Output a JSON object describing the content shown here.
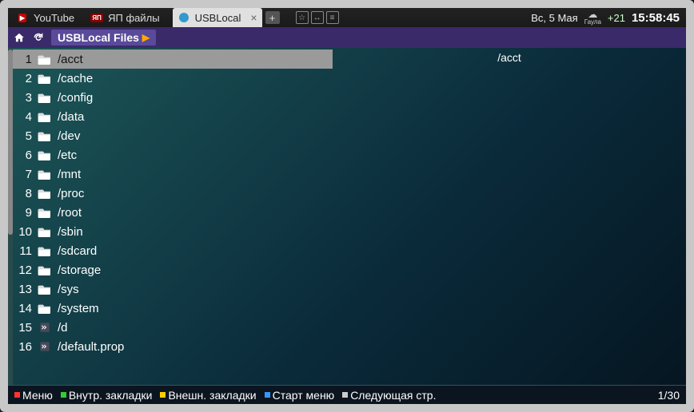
{
  "taskbar": {
    "items": [
      {
        "label": "YouTube",
        "icon": "youtube"
      },
      {
        "label": "ЯП файлы",
        "icon": "yp"
      },
      {
        "label": "USBLocal",
        "icon": "usb",
        "active": true
      }
    ],
    "date": "Вс, 5 Мая",
    "weather_temp": "+21",
    "weather_city": "Гаула",
    "clock": "15:58:45"
  },
  "navbar": {
    "breadcrumb": "USBLocal Files"
  },
  "files": [
    {
      "num": "1",
      "name": "/acct",
      "type": "folder",
      "selected": true
    },
    {
      "num": "2",
      "name": "/cache",
      "type": "folder"
    },
    {
      "num": "3",
      "name": "/config",
      "type": "folder"
    },
    {
      "num": "4",
      "name": "/data",
      "type": "folder"
    },
    {
      "num": "5",
      "name": "/dev",
      "type": "folder"
    },
    {
      "num": "6",
      "name": "/etc",
      "type": "folder"
    },
    {
      "num": "7",
      "name": "/mnt",
      "type": "folder"
    },
    {
      "num": "8",
      "name": "/proc",
      "type": "folder"
    },
    {
      "num": "9",
      "name": "/root",
      "type": "folder"
    },
    {
      "num": "10",
      "name": "/sbin",
      "type": "folder"
    },
    {
      "num": "11",
      "name": "/sdcard",
      "type": "folder"
    },
    {
      "num": "12",
      "name": "/storage",
      "type": "folder"
    },
    {
      "num": "13",
      "name": "/sys",
      "type": "folder"
    },
    {
      "num": "14",
      "name": "/system",
      "type": "folder"
    },
    {
      "num": "15",
      "name": "/d",
      "type": "file"
    },
    {
      "num": "16",
      "name": "/default.prop",
      "type": "file"
    }
  ],
  "detail": {
    "title": "/acct"
  },
  "bottom": {
    "legend": [
      {
        "color": "#ff3333",
        "label": "Меню"
      },
      {
        "color": "#33cc33",
        "label": "Внутр. закладки"
      },
      {
        "color": "#ffcc00",
        "label": "Внешн. закладки"
      },
      {
        "color": "#3399ff",
        "label": "Старт меню"
      },
      {
        "color": "#cccccc",
        "label": "Следующая стр."
      }
    ],
    "page": "1/30"
  }
}
